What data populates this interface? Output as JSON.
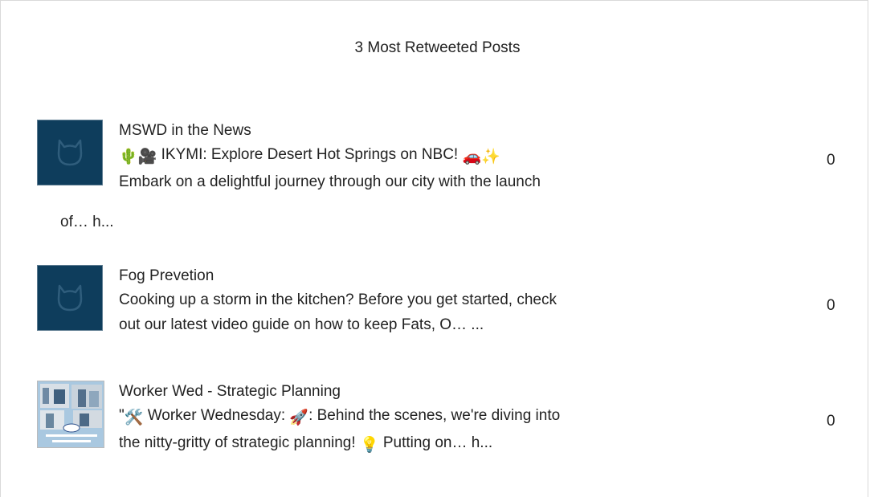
{
  "widget": {
    "title": "3 Most Retweeted Posts"
  },
  "posts": [
    {
      "title": "MSWD in the News",
      "line1": "IKYMI: Explore Desert Hot Springs on NBC!",
      "line2": "Embark on a delightful journey through our city with the launch",
      "line3": "of… h...",
      "count": "0",
      "thumbnail": "placeholder-cat-icon"
    },
    {
      "title": "Fog Prevetion",
      "line1": "Cooking up a storm in the kitchen? Before you get started, check",
      "line2": "out our latest video guide on how to keep Fats, O… ...",
      "count": "0",
      "thumbnail": "placeholder-cat-icon"
    },
    {
      "title": "Worker Wed - Strategic Planning",
      "line1_a": "\"",
      "line1_b": " Worker Wednesday: ",
      "line1_c": ": Behind the scenes, we're diving into",
      "line2_a": "the nitty-gritty of strategic planning! ",
      "line2_b": " Putting on… h...",
      "count": "0",
      "thumbnail": "worker-wednesday-photo"
    }
  ],
  "colors": {
    "thumb_bg": "#0e3d5c",
    "text": "#222222"
  }
}
